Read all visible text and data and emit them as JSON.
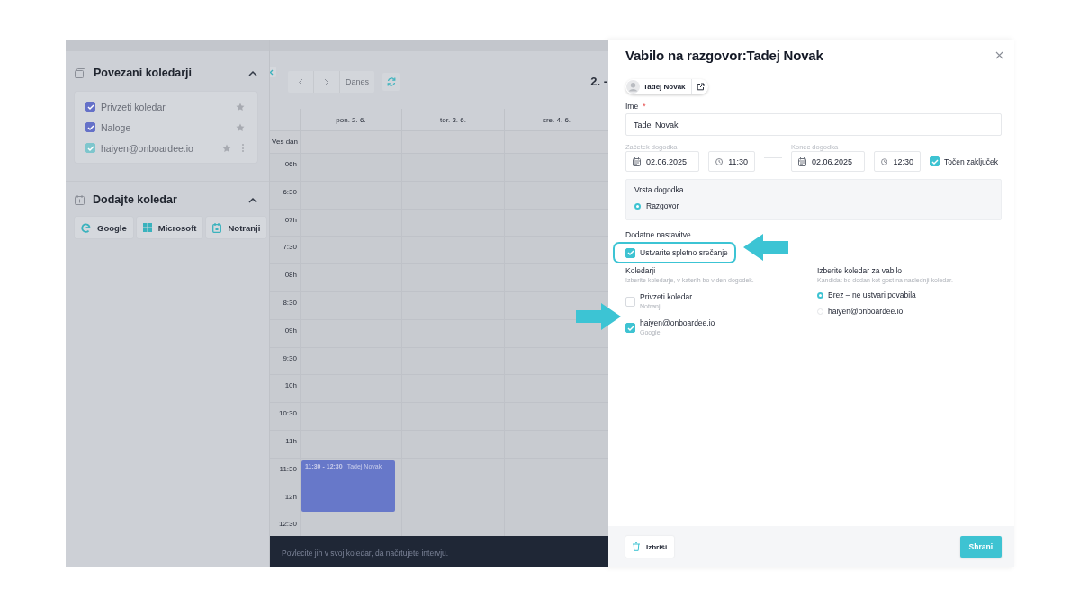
{
  "sidebar": {
    "connected": {
      "title": "Povezani koledarji",
      "expanded": true,
      "calendars": [
        {
          "name": "Privzeti koledar",
          "checked": true,
          "color": "#6571c8"
        },
        {
          "name": "Naloge",
          "checked": true,
          "color": "#6571c8"
        },
        {
          "name": "haiyen@onboardee.io",
          "checked": true,
          "color": "#7ec6cd"
        }
      ]
    },
    "add": {
      "title": "Dodajte koledar",
      "expanded": true,
      "providers": [
        {
          "label": "Google",
          "kind": "google"
        },
        {
          "label": "Microsoft",
          "kind": "microsoft"
        },
        {
          "label": "Notranji",
          "kind": "internal"
        }
      ]
    }
  },
  "calendar": {
    "today": "Danes",
    "range_title": "2. -",
    "all_day": "Ves dan",
    "days": [
      "pon. 2. 6.",
      "tor. 3. 6.",
      "sre. 4. 6."
    ],
    "rows": [
      {
        "time": "06h"
      },
      {
        "time": "6:30"
      },
      {
        "time": "07h"
      },
      {
        "time": "7:30"
      },
      {
        "time": "08h"
      },
      {
        "time": "8:30"
      },
      {
        "time": "09h"
      },
      {
        "time": "9:30"
      },
      {
        "time": "10h"
      },
      {
        "time": "10:30"
      },
      {
        "time": "11h"
      },
      {
        "time": "11:30",
        "event": {
          "time": "11:30 - 12:30",
          "title": "Tadej Novak"
        }
      },
      {
        "time": "12h"
      },
      {
        "time": "12:30"
      }
    ],
    "footer_hint": "Povlecite jih v svoj koledar, da načrtujete intervju."
  },
  "dialog": {
    "title": "Vabilo na razgovor:Tadej Novak",
    "candidate": "Tadej Novak",
    "name_label": "Ime",
    "required_mark": "*",
    "name_value": "Tadej Novak",
    "start": {
      "label": "Začetek dogodka",
      "date": "02.06.2025",
      "time": "11:30"
    },
    "end": {
      "label": "Konec dogodka",
      "date": "02.06.2025",
      "time": "12:30"
    },
    "exact_end": {
      "label": "Točen zaključek",
      "checked": true
    },
    "event_type": {
      "title": "Vrsta dogodka",
      "options": [
        {
          "label": "Razgovor",
          "selected": true
        }
      ]
    },
    "extra": {
      "title": "Dodatne nastavitve",
      "online_meeting": {
        "label": "Ustvarite spletno srečanje",
        "checked": true
      }
    },
    "calendars": {
      "title": "Koledarji",
      "hint": "Izberite koledarje, v katerih bo viden dogodek.",
      "items": [
        {
          "name": "Privzeti koledar",
          "source": "Notranji",
          "checked": false
        },
        {
          "name": "haiyen@onboardee.io",
          "source": "Google",
          "checked": true
        }
      ]
    },
    "invite_calendar": {
      "title": "Izberite koledar za vabilo",
      "hint": "Kandidat bo dodan kot gost na naslednji koledar.",
      "options": [
        {
          "label": "Brez – ne ustvari povabila",
          "selected": true
        },
        {
          "label": "haiyen@onboardee.io",
          "selected": false
        }
      ]
    },
    "delete": "Izbriši",
    "save": "Shrani"
  }
}
